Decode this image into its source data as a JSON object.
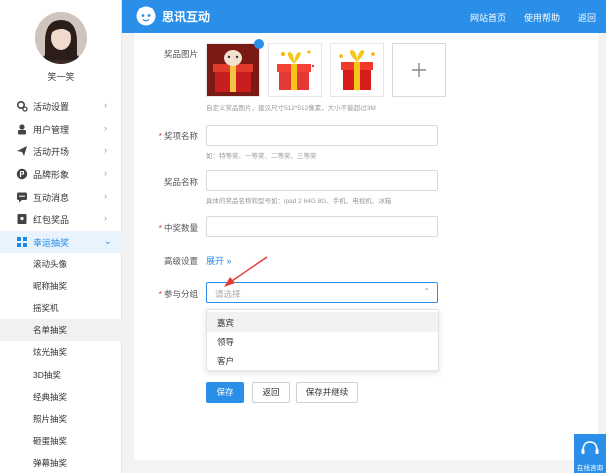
{
  "header": {
    "brand": "思讯互动",
    "links": [
      "网站首页",
      "使用帮助",
      "返回"
    ]
  },
  "user": {
    "name": "笑一笑"
  },
  "sidebar": {
    "items": [
      {
        "label": "活动设置",
        "icon": "gear-icon"
      },
      {
        "label": "用户管理",
        "icon": "user-lock-icon"
      },
      {
        "label": "活动开场",
        "icon": "paper-plane-icon"
      },
      {
        "label": "品牌形象",
        "icon": "brand-icon"
      },
      {
        "label": "互动消息",
        "icon": "message-icon"
      },
      {
        "label": "红包奖品",
        "icon": "gift-icon"
      },
      {
        "label": "幸运抽奖",
        "icon": "grid-icon"
      }
    ],
    "subitems": [
      "滚动头像",
      "昵称抽奖",
      "摇奖机",
      "名单抽奖",
      "炫光抽奖",
      "3D抽奖",
      "经典抽奖",
      "照片抽奖",
      "砸蛋抽奖",
      "弹幕抽奖"
    ]
  },
  "form": {
    "prize_image_label": "奖品图片",
    "prize_image_hint": "自定义奖品图片，建议尺寸512*512像素，大小不能超过3M",
    "item_name_label": "奖项名称",
    "item_name_hint": "如：特等奖、一等奖、二等奖、三等奖",
    "prize_name_label": "奖品名称",
    "prize_name_hint": "具体的奖品名称和型号如：ipad 2 64G 8G、手机、电视机、冰箱",
    "winner_count_label": "中奖数量",
    "advanced_label": "高级设置",
    "expand_label": "展开 »",
    "group_label": "参与分组",
    "group_placeholder": "请选择",
    "group_options": [
      "嘉宾",
      "领导",
      "客户"
    ],
    "save_label": "保存",
    "back_label": "返回",
    "save_continue_label": "保存并继续",
    "required_mark": "*"
  },
  "consult": {
    "label": "在线咨询"
  },
  "colors": {
    "accent": "#2a8fe8",
    "required": "#e53935",
    "arrow": "#e53935"
  }
}
